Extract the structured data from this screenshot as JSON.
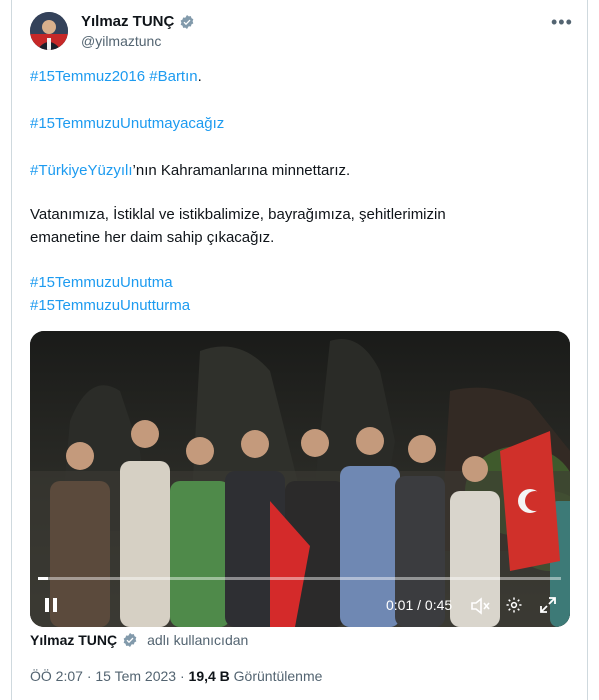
{
  "author": {
    "name": "Yılmaz TUNÇ",
    "handle": "@yilmaztunc",
    "verified_color": "#829aab"
  },
  "tweet": {
    "line1_tag_a": "#15Temmuz2016",
    "line1_tag_b": "#Bartın",
    "line1_dot": ".",
    "line2_tag": "#15TemmuzuUnutmayacağız",
    "line3_tag": "#TürkiyeYüzyılı",
    "line3_text": "’nın Kahramanlarına minnettarız.",
    "line4_text": "Vatanımıza, İstiklal ve istikbalimize, bayrağımıza, şehitlerimizin",
    "line5_text": "emanetine her daim sahip çıkacağız.",
    "line6_tag": "#15TemmuzuUnutma",
    "line7_tag": "#15TemmuzuUnutturma"
  },
  "video": {
    "time": "0:01 / 0:45",
    "progress": 0.02
  },
  "footer": {
    "name": "Yılmaz TUNÇ",
    "sub": "adlı kullanıcıdan"
  },
  "meta": {
    "time": "ÖÖ 2:07",
    "sep": "·",
    "date": "15 Tem 2023",
    "views": "19,4 B",
    "views_label": "Görüntülenme"
  },
  "colors": {
    "link": "#1d9bf0",
    "muted": "#536471",
    "text": "#0f1419"
  },
  "icons": [
    "verified-badge-icon",
    "more-icon",
    "play-pause-icon",
    "volume-mute-icon",
    "settings-gear-icon",
    "fullscreen-icon"
  ]
}
